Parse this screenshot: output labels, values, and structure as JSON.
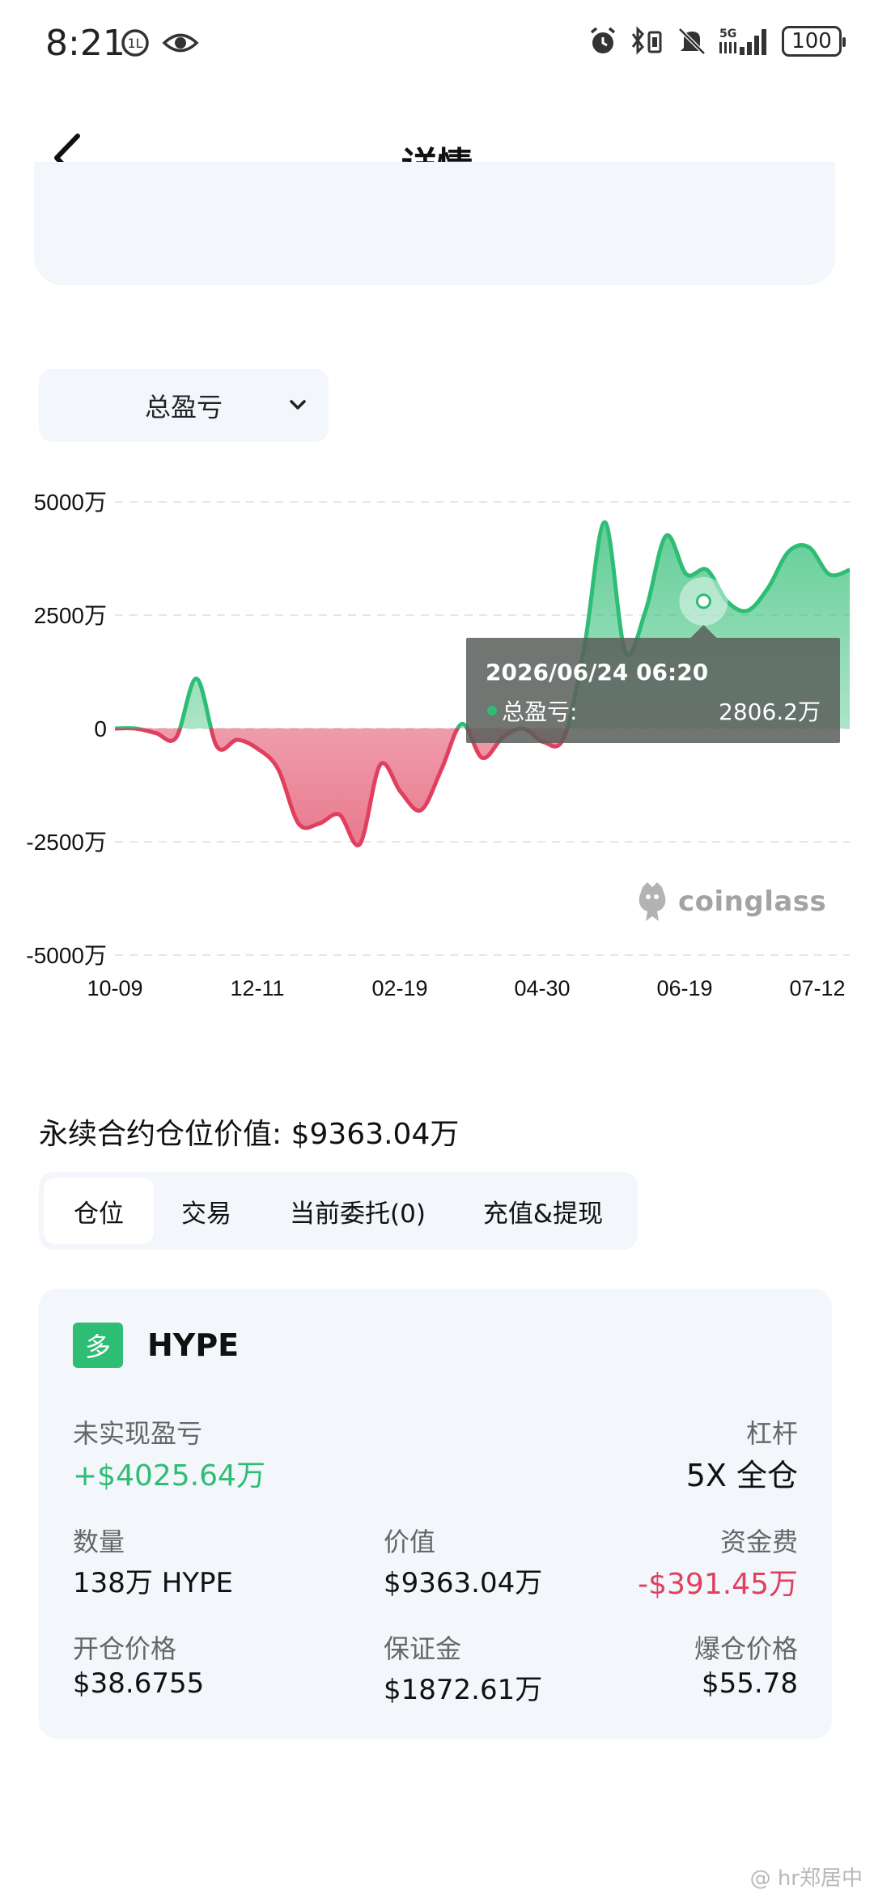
{
  "status_bar": {
    "time": "8:21",
    "network": "5G",
    "battery": "100",
    "icons": [
      "hd-icon",
      "eye-icon",
      "alarm-icon",
      "bluetooth-icon",
      "vibrate-icon",
      "mute-icon",
      "signal-icon",
      "battery-icon"
    ]
  },
  "header": {
    "title": "详情"
  },
  "metric_select": {
    "selected": "总盈亏"
  },
  "chart_data": {
    "type": "area",
    "title": "",
    "xlabel": "",
    "ylabel": "",
    "ylim": [
      -5000,
      5000
    ],
    "y_unit": "万",
    "y_ticks": [
      "5000万",
      "2500万",
      "0",
      "-2500万",
      "-5000万"
    ],
    "x_ticks": [
      "10-09",
      "12-11",
      "02-19",
      "04-30",
      "06-19",
      "07-12"
    ],
    "grid": true,
    "colors": {
      "positive": "#2ebd74",
      "negative": "#e0405e"
    },
    "series": [
      {
        "values": [
          0,
          0,
          -100,
          -200,
          1100,
          -400,
          -250,
          -450,
          -900,
          -2100,
          -2100,
          -1900,
          -2550,
          -800,
          -1400,
          -1800,
          -900,
          100,
          -650,
          -200,
          0,
          -300,
          -200,
          1800,
          4550,
          1700,
          2600,
          4250,
          3400,
          3500,
          2800,
          2600,
          3100,
          3900,
          4000,
          3400,
          3500
        ]
      }
    ],
    "tooltip": {
      "date": "2026/06/24 06:20",
      "label": "总盈亏:",
      "value": "2806.2万"
    },
    "watermark": "coinglass"
  },
  "position_value": {
    "label": "永续合约仓位价值: $9363.04万"
  },
  "tabs": [
    {
      "label": "仓位",
      "active": true
    },
    {
      "label": "交易",
      "active": false
    },
    {
      "label": "当前委托(0)",
      "active": false
    },
    {
      "label": "充值&提现",
      "active": false
    }
  ],
  "position": {
    "side": "多",
    "symbol": "HYPE",
    "unrealized_pnl_label": "未实现盈亏",
    "unrealized_pnl": "+$4025.64万",
    "leverage_label": "杠杆",
    "leverage": "5X 全仓",
    "qty_label": "数量",
    "qty": "138万 HYPE",
    "value_label": "价值",
    "value": "$9363.04万",
    "funding_label": "资金费",
    "funding": "-$391.45万",
    "entry_label": "开仓价格",
    "entry": "$38.6755",
    "margin_label": "保证金",
    "margin": "$1872.61万",
    "liq_label": "爆仓价格",
    "liq": "$55.78"
  },
  "footer_watermark": "@ hr郑居中"
}
